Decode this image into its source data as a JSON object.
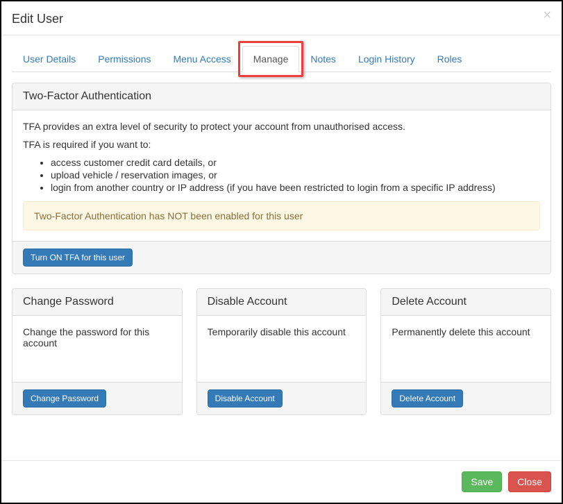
{
  "modal": {
    "title": "Edit User",
    "close_icon": "×"
  },
  "tabs": [
    {
      "label": "User Details"
    },
    {
      "label": "Permissions"
    },
    {
      "label": "Menu Access"
    },
    {
      "label": "Manage"
    },
    {
      "label": "Notes"
    },
    {
      "label": "Login History"
    },
    {
      "label": "Roles"
    }
  ],
  "tfa_panel": {
    "title": "Two-Factor Authentication",
    "intro": "TFA provides an extra level of security to protect your account from unauthorised access.",
    "required_intro": "TFA is required if you want to:",
    "bullets": [
      "access customer credit card details, or",
      "upload vehicle / reservation images, or",
      "login from another country or IP address (if you have been restricted to login from a specific IP address)"
    ],
    "warning": "Two-Factor Authentication has NOT been enabled for this user",
    "button": "Turn ON TFA for this user"
  },
  "cards": {
    "change_password": {
      "title": "Change Password",
      "body": "Change the password for this account",
      "button": "Change Password"
    },
    "disable_account": {
      "title": "Disable Account",
      "body": "Temporarily disable this account",
      "button": "Disable Account"
    },
    "delete_account": {
      "title": "Delete Account",
      "body": "Permanently delete this account",
      "button": "Delete Account"
    }
  },
  "footer": {
    "save": "Save",
    "close": "Close"
  }
}
